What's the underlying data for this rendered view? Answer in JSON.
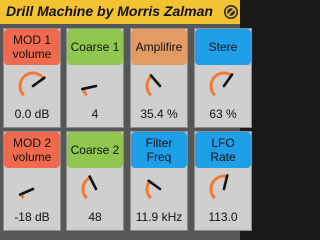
{
  "title": "Drill Machine by Morris Zalman",
  "title_icon": "hot-swap-icon",
  "colors": {
    "titlebar": "#f2c230",
    "panel": "#575757",
    "cell": "#cfcfcf",
    "red": "#f06a4f",
    "green": "#8fc74f",
    "orange": "#e49a63",
    "blue": "#1f9fe8",
    "knob_arc": "#f27a33",
    "knob_pointer": "#111111"
  },
  "rows": [
    [
      {
        "label": [
          "MOD 1",
          "volume"
        ],
        "value": "0.0 dB",
        "color": "red",
        "level": 0.7
      },
      {
        "label": [
          "Coarse  1"
        ],
        "value": "4",
        "color": "green",
        "level": 0.12
      },
      {
        "label": [
          "Amplifire"
        ],
        "value": "35.4 %",
        "color": "orange",
        "level": 0.35
      },
      {
        "label": [
          "Stere"
        ],
        "value": "63 %",
        "color": "blue",
        "level": 0.63
      }
    ],
    [
      {
        "label": [
          "MOD 2",
          "volume"
        ],
        "value": "-18 dB",
        "color": "red",
        "level": 0.08
      },
      {
        "label": [
          "Coarse  2"
        ],
        "value": "48",
        "color": "green",
        "level": 0.4
      },
      {
        "label": [
          "Filter",
          "Freq"
        ],
        "value": "11.9 kHz",
        "color": "blue",
        "level": 0.3
      },
      {
        "label": [
          "LFO",
          "Rate"
        ],
        "value": "113.0",
        "color": "blue",
        "level": 0.55
      }
    ]
  ]
}
